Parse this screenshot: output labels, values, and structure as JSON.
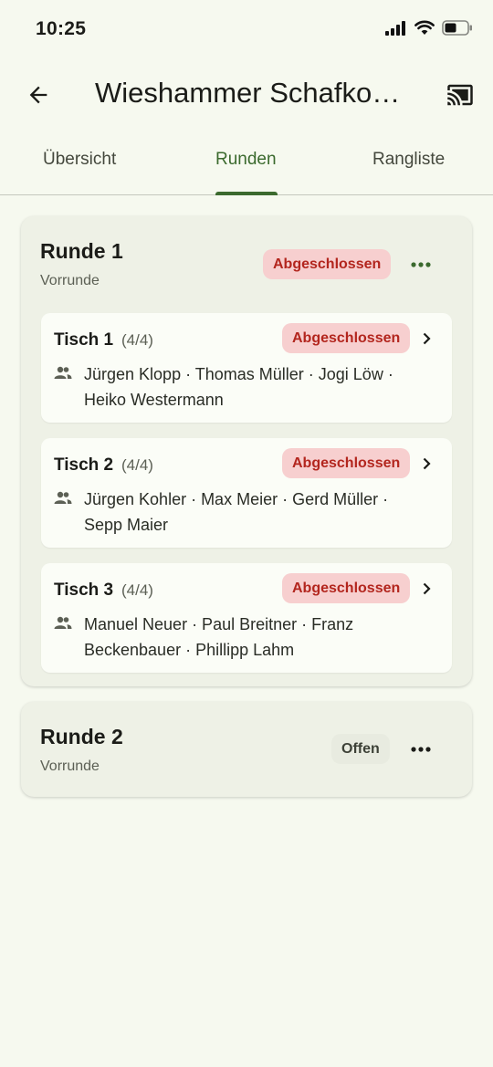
{
  "status_bar": {
    "time": "10:25"
  },
  "app_bar": {
    "title": "Wieshammer Schafko…",
    "icons": [
      "back-arrow-icon",
      "cast-icon"
    ]
  },
  "tabs": [
    {
      "label": "Übersicht",
      "active": false
    },
    {
      "label": "Runden",
      "active": true
    },
    {
      "label": "Rangliste",
      "active": false
    }
  ],
  "colors": {
    "accent": "#3b6a2e",
    "done_badge_bg": "#f7cfcf",
    "done_badge_text": "#b3261e",
    "background": "#f6f9ef"
  },
  "rounds": [
    {
      "title": "Runde 1",
      "subtitle": "Vorrunde",
      "status": "Abgeschlossen",
      "tables": [
        {
          "title": "Tisch 1",
          "count": "(4/4)",
          "status": "Abgeschlossen",
          "players": "Jürgen Klopp · Thomas Müller · Jogi Löw · Heiko Westermann"
        },
        {
          "title": "Tisch 2",
          "count": "(4/4)",
          "status": "Abgeschlossen",
          "players": "Jürgen Kohler · Max Meier · Gerd Müller · Sepp Maier"
        },
        {
          "title": "Tisch 3",
          "count": "(4/4)",
          "status": "Abgeschlossen",
          "players": "Manuel Neuer · Paul Breitner · Franz Beckenbauer · Phillipp Lahm"
        }
      ]
    },
    {
      "title": "Runde 2",
      "subtitle": "Vorrunde",
      "status": "Offen",
      "tables": []
    }
  ]
}
